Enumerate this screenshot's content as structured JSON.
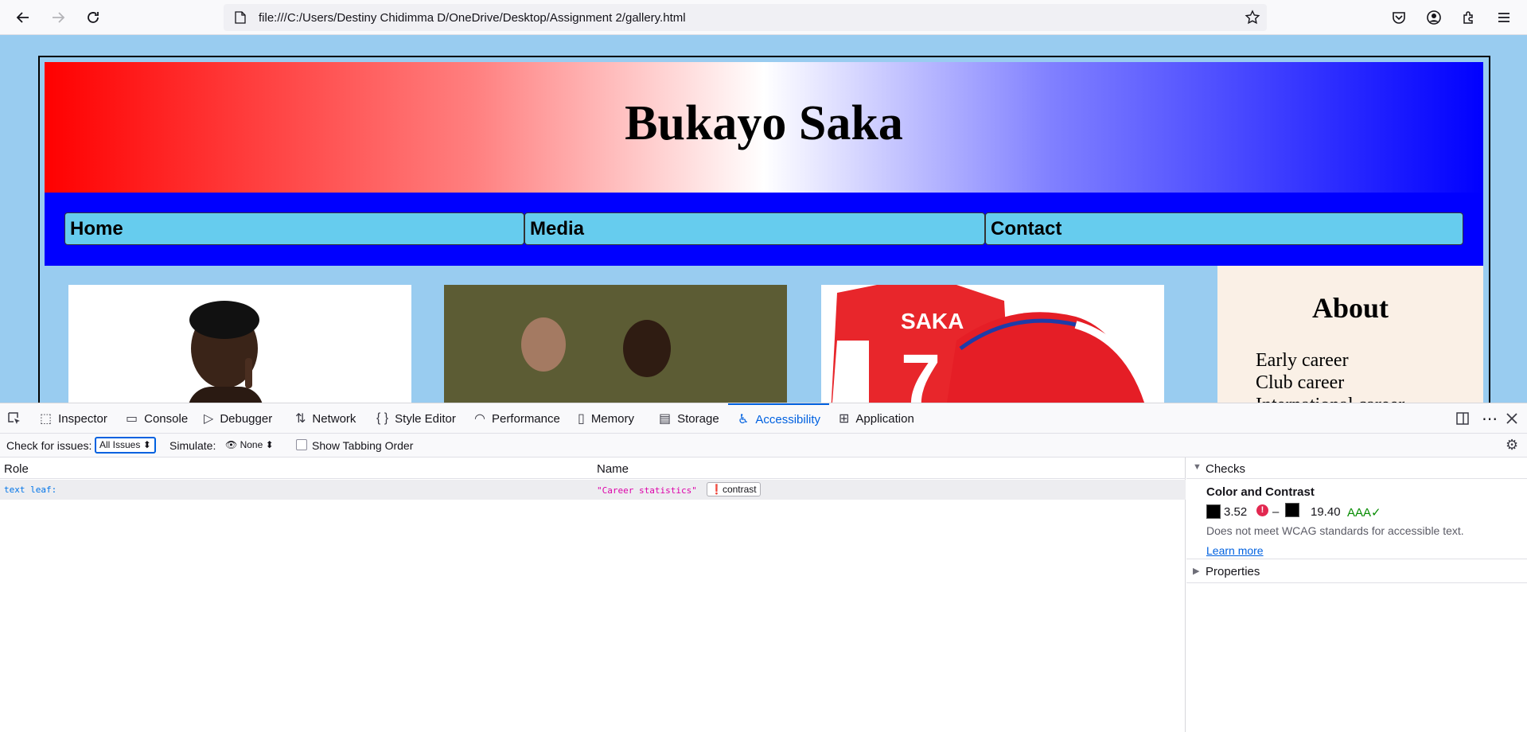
{
  "browser": {
    "url": "file:///C:/Users/Destiny Chidimma D/OneDrive/Desktop/Assignment 2/gallery.html"
  },
  "page": {
    "title": "Bukayo Saka",
    "nav": [
      "Home",
      "Media",
      "Contact"
    ],
    "about": {
      "heading": "About",
      "items": [
        "Early career",
        "Club career",
        "International career"
      ]
    },
    "jersey_text": "SAKA",
    "jersey_number": "7"
  },
  "devtools": {
    "tabs": [
      "Inspector",
      "Console",
      "Debugger",
      "Network",
      "Style Editor",
      "Performance",
      "Memory",
      "Storage",
      "Accessibility",
      "Application"
    ],
    "selected_tab": "Accessibility",
    "toolbar": {
      "check_label": "Check for issues:",
      "check_value": "All Issues",
      "simulate_label": "Simulate:",
      "simulate_value": "None",
      "tabbing_label": "Show Tabbing Order"
    },
    "tree": {
      "col_role": "Role",
      "col_name": "Name",
      "row_role": "text leaf:",
      "row_name": "\"Career statistics\"",
      "row_badge": "contrast"
    },
    "sidebar": {
      "checks_label": "Checks",
      "section_title": "Color and Contrast",
      "ratio_low": "3.52",
      "dash": "–",
      "ratio_high": "19.40",
      "grade": "AAA✓",
      "message": "Does not meet WCAG standards for accessible text.",
      "learn_more": "Learn more",
      "properties_label": "Properties"
    }
  },
  "colors": {
    "accent": "#0061e0",
    "error": "#e22850",
    "pass": "#058b00"
  }
}
